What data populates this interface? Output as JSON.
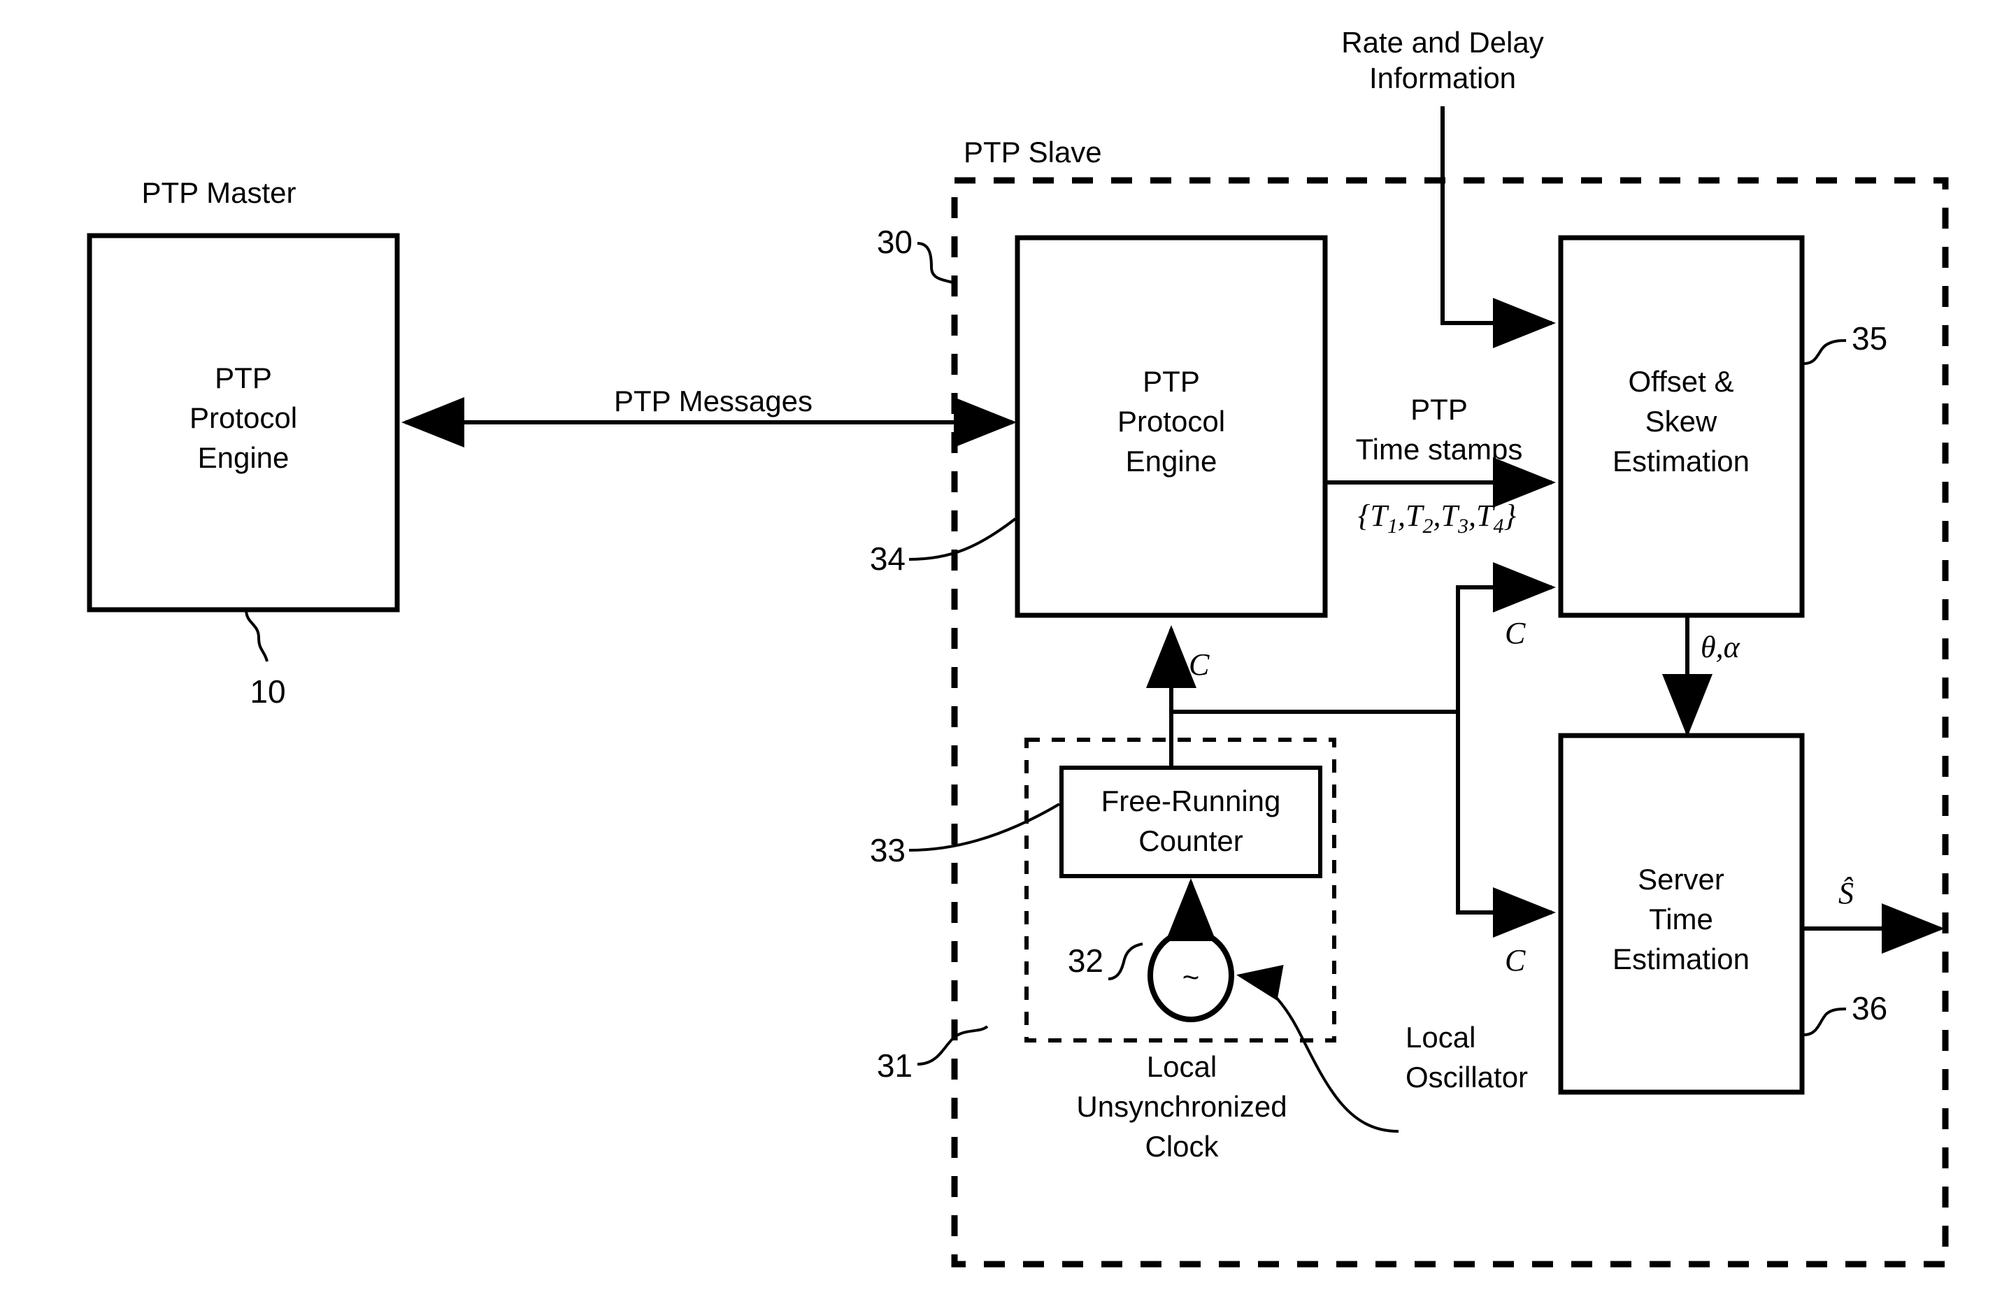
{
  "figure": {
    "type": "block-diagram",
    "title_master": "PTP Master",
    "title_slave": "PTP Slave"
  },
  "master": {
    "label": "PTP Master",
    "box": {
      "line1": "PTP",
      "line2": "Protocol",
      "line3": "Engine"
    },
    "ref": "10"
  },
  "link": {
    "label": "PTP Messages"
  },
  "slave": {
    "label": "PTP Slave",
    "ref": "30",
    "protocol_engine": {
      "line1": "PTP",
      "line2": "Protocol",
      "line3": "Engine",
      "ref": "34"
    },
    "offset_skew": {
      "line1": "Offset &",
      "line2": "Skew",
      "line3": "Estimation",
      "ref": "35"
    },
    "server_time": {
      "line1": "Server",
      "line2": "Time",
      "line3": "Estimation",
      "ref": "36"
    },
    "local_clock": {
      "label_line1": "Local",
      "label_line2": "Unsynchronized",
      "label_line3": "Clock",
      "ref": "31",
      "counter": {
        "line1": "Free-Running",
        "line2": "Counter",
        "ref": "33"
      },
      "oscillator": {
        "symbol": "~",
        "ref": "32",
        "label_line1": "Local",
        "label_line2": "Oscillator"
      }
    }
  },
  "signals": {
    "rate_delay_line1": "Rate and Delay",
    "rate_delay_line2": "Information",
    "timestamps_line1": "PTP",
    "timestamps_line2": "Time stamps",
    "timestamps_set_open": "{",
    "timestamps_set_close": "}",
    "timestamps_vars": [
      "T",
      "T",
      "T",
      "T"
    ],
    "timestamps_subs": [
      "1",
      "2",
      "3",
      "4"
    ],
    "clock_symbol_engine": "C",
    "clock_symbol_offset": "C",
    "clock_symbol_server": "C",
    "theta_alpha": "θ,α",
    "server_output": "Ŝ"
  },
  "style": {
    "ink": "#000000",
    "paper": "#ffffff"
  }
}
